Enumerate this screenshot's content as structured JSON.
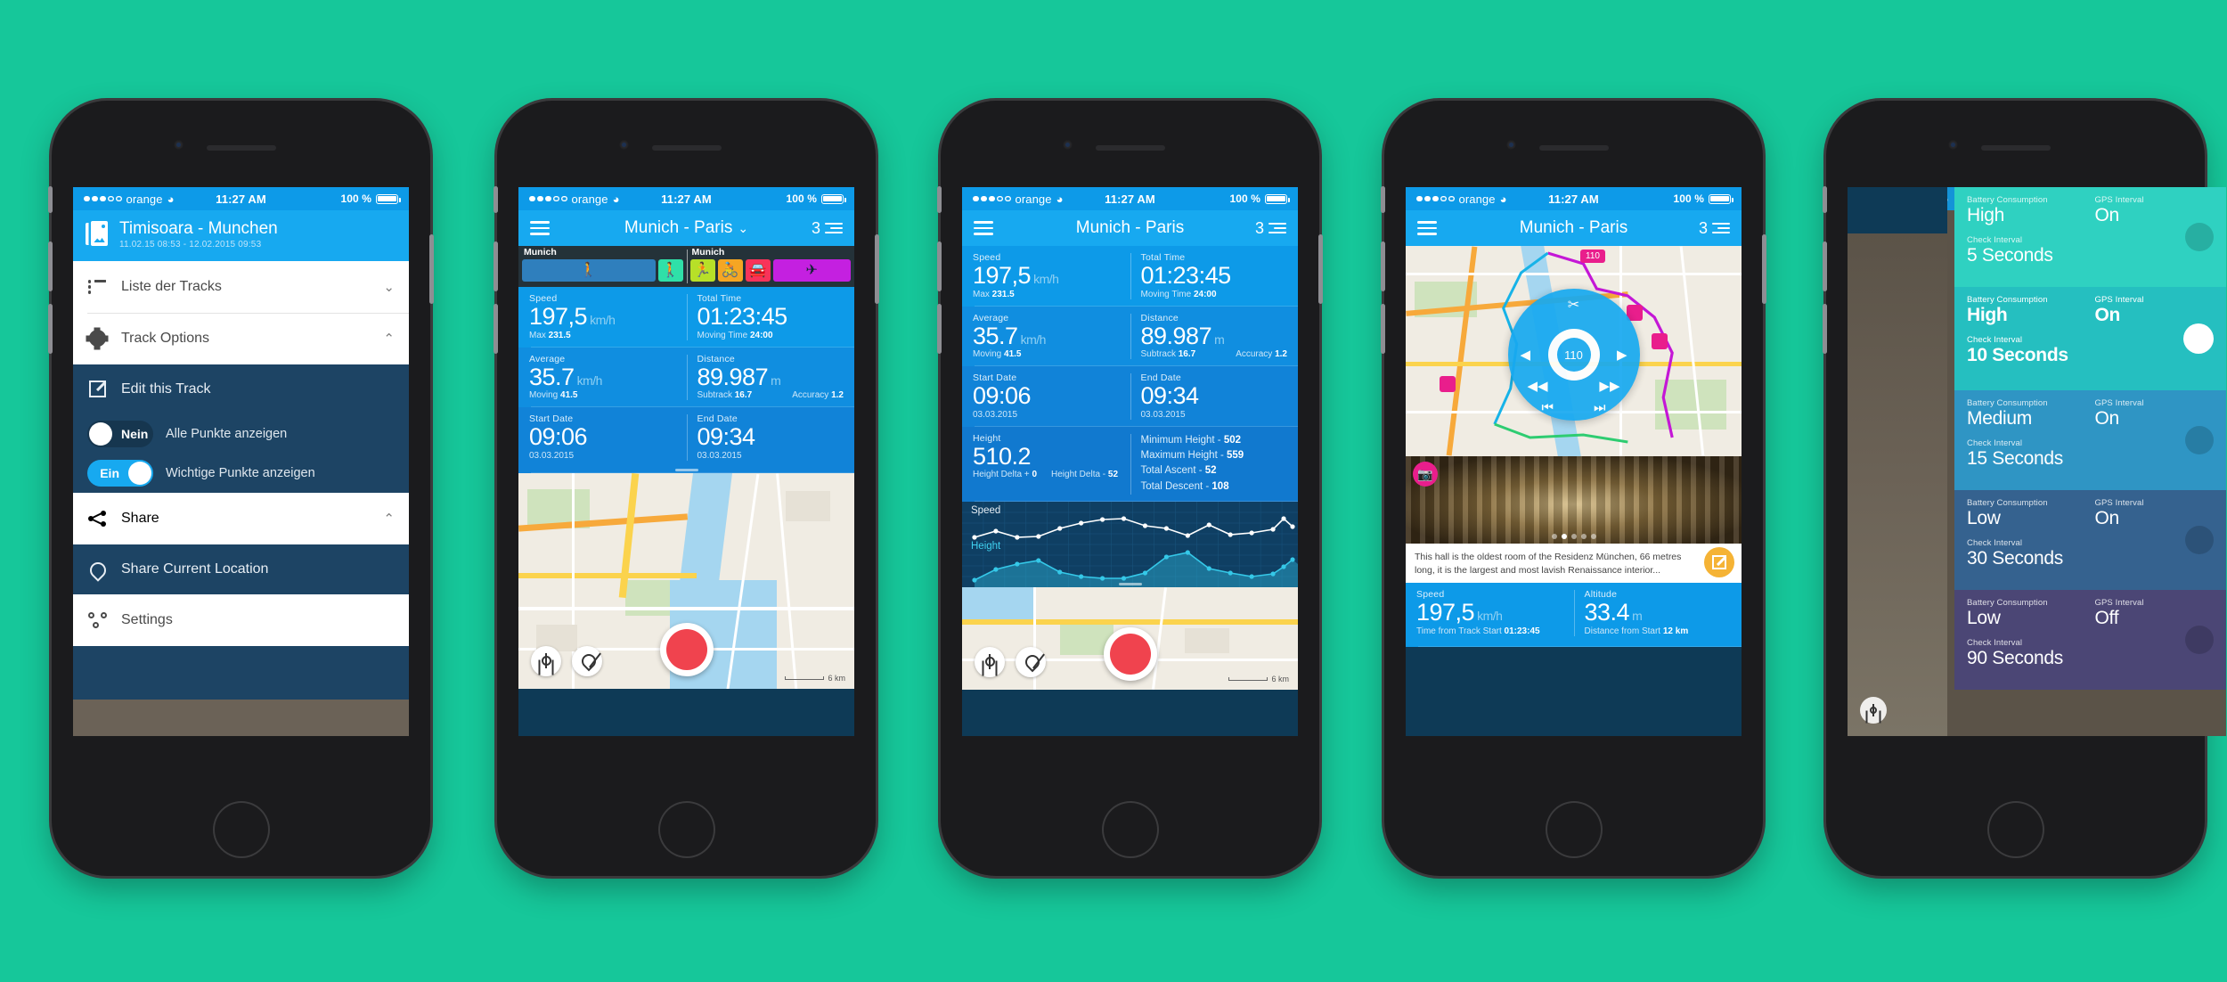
{
  "background_color": "#16c79a",
  "status_bar": {
    "carrier": "orange",
    "signal_dots": "3 of 5",
    "wifi_icon": "wifi-icon",
    "time": "11:27 AM",
    "battery_percent": "100 %"
  },
  "phone1": {
    "header": {
      "icon": "photo-stack-icon",
      "title": "Timisoara - Munchen",
      "subtitle": "11.02.15  08:53  -  12.02.2015  09:53"
    },
    "menu_white": [
      {
        "icon": "list-icon",
        "label": "Liste der Tracks",
        "chevron": "⌄"
      },
      {
        "icon": "gear-icon",
        "label": "Track Options",
        "chevron": "⌃"
      }
    ],
    "menu_dark": [
      {
        "icon": "edit-icon",
        "label": "Edit this Track"
      }
    ],
    "toggles": [
      {
        "state_label": "Nein",
        "text": "Alle Punkte anzeigen",
        "on": false
      },
      {
        "state_label": "Ein",
        "text": "Wichtige Punkte anzeigen",
        "on": true
      }
    ],
    "share_row": {
      "icon": "share-icon",
      "label": "Share",
      "chevron": "⌃"
    },
    "menu_dark2": [
      {
        "icon": "location-icon",
        "label": "Share Current Location"
      }
    ],
    "settings_row": {
      "icon": "settings-icon",
      "label": "Settings"
    }
  },
  "phone2": {
    "nav": {
      "menu_icon": "hamburger-icon",
      "title": "Munich - Paris",
      "chevron": "⌄",
      "count": "3",
      "list_icon": "list-lines-icon"
    },
    "activity_strip": {
      "segments": [
        {
          "name": "Munich",
          "icons": [
            {
              "name": "standing-person-icon",
              "glyph": "🚶",
              "color": "#2f7fbd",
              "wide": true
            },
            {
              "name": "walking-icon",
              "glyph": "🚶",
              "color": "#2fe0a8",
              "wide": false
            }
          ]
        },
        {
          "name": "Munich",
          "icons": [
            {
              "name": "running-icon",
              "glyph": "🏃",
              "color": "#b7e028",
              "wide": false
            },
            {
              "name": "cycling-icon",
              "glyph": "🚴",
              "color": "#f5a623",
              "wide": false
            },
            {
              "name": "car-icon",
              "glyph": "🚗",
              "color": "#f8335a",
              "wide": false
            },
            {
              "name": "plane-icon",
              "glyph": "✈",
              "color": "#c420e0",
              "wide": true
            }
          ]
        }
      ]
    },
    "stats": [
      {
        "cells": [
          {
            "label": "Speed",
            "value": "197,5",
            "unit": "km/h",
            "foot": [
              [
                "Max ",
                "231.5"
              ]
            ]
          },
          {
            "label": "Total Time",
            "value": "01:23:45",
            "unit": "",
            "foot": [
              [
                "Moving Time ",
                "24:00"
              ]
            ]
          }
        ]
      },
      {
        "cells": [
          {
            "label": "Average",
            "value": "35.7",
            "unit": "km/h",
            "foot": [
              [
                "Moving ",
                "41.5"
              ]
            ]
          },
          {
            "label": "Distance",
            "value": "89.987",
            "unit": "m",
            "foot": [
              [
                "Subtrack ",
                "16.7"
              ],
              [
                "Accuracy ",
                "1.2"
              ]
            ]
          }
        ]
      },
      {
        "cells": [
          {
            "label": "Start Date",
            "value": "09:06",
            "unit": "",
            "foot": [
              [
                "03.03.2015",
                ""
              ]
            ]
          },
          {
            "label": "End Date",
            "value": "09:34",
            "unit": "",
            "foot": [
              [
                "03.03.2015",
                ""
              ]
            ]
          }
        ]
      }
    ],
    "map_buttons": [
      {
        "name": "locate-button",
        "icon": "crosshair-icon"
      },
      {
        "name": "marker-button",
        "icon": "pin-icon"
      },
      {
        "name": "record-button",
        "icon": "record-circle-icon"
      }
    ],
    "map_scale": "6 km"
  },
  "phone3": {
    "nav": {
      "menu_icon": "hamburger-icon",
      "title": "Munich - Paris",
      "chevron": "",
      "count": "3",
      "list_icon": "list-lines-icon"
    },
    "stats": [
      {
        "cells": [
          {
            "label": "Speed",
            "value": "197,5",
            "unit": "km/h",
            "foot": [
              [
                "Max ",
                "231.5"
              ]
            ]
          },
          {
            "label": "Total Time",
            "value": "01:23:45",
            "unit": "",
            "foot": [
              [
                "Moving Time ",
                "24:00"
              ]
            ]
          }
        ]
      },
      {
        "cells": [
          {
            "label": "Average",
            "value": "35.7",
            "unit": "km/h",
            "foot": [
              [
                "Moving ",
                "41.5"
              ]
            ]
          },
          {
            "label": "Distance",
            "value": "89.987",
            "unit": "m",
            "foot": [
              [
                "Subtrack ",
                "16.7"
              ],
              [
                "Accuracy ",
                "1.2"
              ]
            ]
          }
        ]
      },
      {
        "cells": [
          {
            "label": "Start Date",
            "value": "09:06",
            "unit": "",
            "foot": [
              [
                "03.03.2015",
                ""
              ]
            ]
          },
          {
            "label": "End Date",
            "value": "09:34",
            "unit": "",
            "foot": [
              [
                "03.03.2015",
                ""
              ]
            ]
          }
        ]
      }
    ],
    "height_block": {
      "label": "Height",
      "value": "510.2",
      "foot_left": "Height Delta + ",
      "foot_left_value": "0",
      "foot_right": "Height Delta - ",
      "foot_right_value": "52",
      "list": [
        {
          "label": "Minimum Height - ",
          "value": "502"
        },
        {
          "label": "Maximum Height - ",
          "value": "559"
        },
        {
          "label": "Total Ascent - ",
          "value": "52"
        },
        {
          "label": "Total Descent - ",
          "value": "108"
        }
      ]
    },
    "map_scale": "6 km"
  },
  "phone4": {
    "nav": {
      "menu_icon": "hamburger-icon",
      "title": "Munich - Paris",
      "chevron": "",
      "count": "3",
      "list_icon": "list-lines-icon"
    },
    "player": {
      "scissors_icon": "scissors-icon",
      "prev_icon": "◀",
      "next_icon": "▶",
      "rewind_icon": "◀◀",
      "forward_icon": "▶▶",
      "skip_back_icon": "⏮",
      "skip_fwd_icon": "⏭",
      "center_badge": "110"
    },
    "map_markers": [
      "110",
      "pin-photo-icon",
      "pin-photo-icon"
    ],
    "photo": {
      "camera_badge": "camera-icon",
      "dots": 5,
      "active_dot": 2
    },
    "caption": {
      "text": "This hall is the oldest room of the Residenz München, 66 metres long, it is the largest and most lavish Renaissance interior...",
      "edit_icon": "edit-icon"
    },
    "stats": [
      {
        "label": "Speed",
        "value": "197,5",
        "unit": "km/h",
        "foot_label": "Time from Track Start ",
        "foot_value": "01:23:45"
      },
      {
        "label": "Altitude",
        "value": "33.4",
        "unit": "m",
        "foot_label": "Distance from Start ",
        "foot_value": "12 km"
      }
    ]
  },
  "phone5": {
    "settings_rows": [
      {
        "battery_label": "Battery Consumption",
        "battery_value": "High",
        "gps_label": "GPS Interval",
        "gps_value": "On",
        "interval_label": "Check Interval",
        "interval_value": "5 Seconds",
        "color": "#2fd1c1",
        "active": false
      },
      {
        "battery_label": "Battery Consumption",
        "battery_value": "High",
        "gps_label": "GPS Interval",
        "gps_value": "On",
        "interval_label": "Check Interval",
        "interval_value": "10 Seconds",
        "color": "#25bfc0",
        "active": true
      },
      {
        "battery_label": "Battery Consumption",
        "battery_value": "Medium",
        "gps_label": "GPS Interval",
        "gps_value": "On",
        "interval_label": "Check Interval",
        "interval_value": "15 Seconds",
        "color": "#2f95c4",
        "active": false
      },
      {
        "battery_label": "Battery Consumption",
        "battery_value": "Low",
        "gps_label": "GPS Interval",
        "gps_value": "On",
        "interval_label": "Check Interval",
        "interval_value": "30 Seconds",
        "color": "#35628f",
        "active": false
      },
      {
        "battery_label": "Battery Consumption",
        "battery_value": "Low",
        "gps_label": "GPS Interval",
        "gps_value": "Off",
        "interval_label": "Check Interval",
        "interval_value": "90 Seconds",
        "color": "#4b4675",
        "active": false
      }
    ],
    "compass_icon": "compass-icon"
  },
  "chart_data": {
    "type": "line",
    "title": "Speed & Height profile",
    "series": [
      {
        "name": "Speed",
        "color": "#ffffff",
        "values": [
          22,
          40,
          24,
          28,
          52,
          66,
          74,
          76,
          60,
          54,
          30,
          50,
          28,
          32,
          42,
          70,
          44
        ]
      },
      {
        "name": "Height",
        "color": "#35c8e8",
        "values": [
          4,
          30,
          42,
          50,
          28,
          16,
          12,
          10,
          24,
          62,
          72,
          26,
          16,
          12,
          18,
          34,
          56,
          62,
          40
        ]
      }
    ],
    "xlabel": "",
    "ylabel": "",
    "grid": true,
    "legend": "inline-left"
  }
}
